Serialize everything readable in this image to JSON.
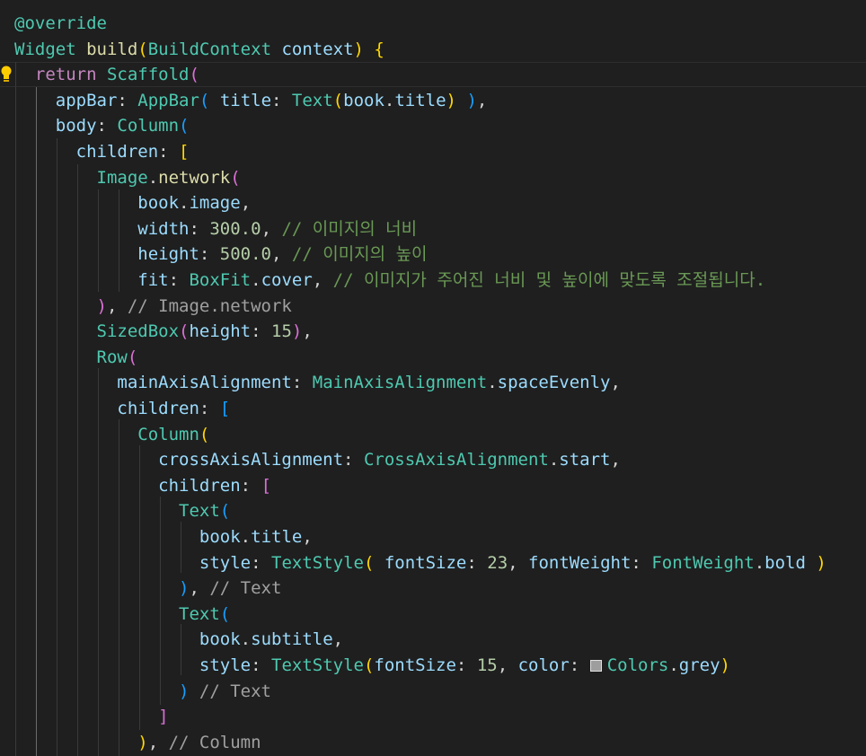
{
  "editor": {
    "theme": {
      "background": "#1f1f1f",
      "bracket_1": "#ffd700",
      "bracket_2": "#da70d6",
      "bracket_3": "#179fff"
    },
    "lightbulb_icon": "lightbulb-icon",
    "color_swatch": "#9e9e9e",
    "lines": [
      {
        "segs": [
          {
            "t": "@override",
            "c": "dec"
          }
        ]
      },
      {
        "segs": [
          {
            "t": "Widget ",
            "c": "ty"
          },
          {
            "t": "build",
            "c": "fn"
          },
          {
            "t": "(",
            "c": "b1"
          },
          {
            "t": "BuildContext ",
            "c": "ty"
          },
          {
            "t": "context",
            "c": "prop"
          },
          {
            "t": ") ",
            "c": "b1"
          },
          {
            "t": "{",
            "c": "b1"
          }
        ]
      },
      {
        "segs": [
          {
            "t": "  return ",
            "c": "kw"
          },
          {
            "t": "Scaffold",
            "c": "ty"
          },
          {
            "t": "(",
            "c": "b2"
          }
        ]
      },
      {
        "segs": [
          {
            "t": "    appBar",
            "c": "prop"
          },
          {
            "t": ": ",
            "c": "p"
          },
          {
            "t": "AppBar",
            "c": "ty"
          },
          {
            "t": "(",
            "c": "b3"
          },
          {
            "t": " title",
            "c": "prop"
          },
          {
            "t": ": ",
            "c": "p"
          },
          {
            "t": "Text",
            "c": "ty"
          },
          {
            "t": "(",
            "c": "b1"
          },
          {
            "t": "book",
            "c": "prop"
          },
          {
            "t": ".",
            "c": "p"
          },
          {
            "t": "title",
            "c": "prop"
          },
          {
            "t": ")",
            "c": "b1"
          },
          {
            "t": " ",
            "c": "p"
          },
          {
            "t": ")",
            "c": "b3"
          },
          {
            "t": ",",
            "c": "p"
          }
        ]
      },
      {
        "segs": [
          {
            "t": "    body",
            "c": "prop"
          },
          {
            "t": ": ",
            "c": "p"
          },
          {
            "t": "Column",
            "c": "ty"
          },
          {
            "t": "(",
            "c": "b3"
          }
        ]
      },
      {
        "segs": [
          {
            "t": "      children",
            "c": "prop"
          },
          {
            "t": ": ",
            "c": "p"
          },
          {
            "t": "[",
            "c": "b1"
          }
        ]
      },
      {
        "segs": [
          {
            "t": "        Image",
            "c": "ty"
          },
          {
            "t": ".",
            "c": "p"
          },
          {
            "t": "network",
            "c": "fn"
          },
          {
            "t": "(",
            "c": "b2"
          }
        ]
      },
      {
        "segs": [
          {
            "t": "            book",
            "c": "prop"
          },
          {
            "t": ".",
            "c": "p"
          },
          {
            "t": "image",
            "c": "prop"
          },
          {
            "t": ",",
            "c": "p"
          }
        ]
      },
      {
        "segs": [
          {
            "t": "            width",
            "c": "prop"
          },
          {
            "t": ": ",
            "c": "p"
          },
          {
            "t": "300.0",
            "c": "num"
          },
          {
            "t": ", ",
            "c": "p"
          },
          {
            "t": "// 이미지의 너비",
            "c": "cm"
          }
        ]
      },
      {
        "segs": [
          {
            "t": "            height",
            "c": "prop"
          },
          {
            "t": ": ",
            "c": "p"
          },
          {
            "t": "500.0",
            "c": "num"
          },
          {
            "t": ", ",
            "c": "p"
          },
          {
            "t": "// 이미지의 높이",
            "c": "cm"
          }
        ]
      },
      {
        "segs": [
          {
            "t": "            fit",
            "c": "prop"
          },
          {
            "t": ": ",
            "c": "p"
          },
          {
            "t": "BoxFit",
            "c": "ty"
          },
          {
            "t": ".",
            "c": "p"
          },
          {
            "t": "cover",
            "c": "prop"
          },
          {
            "t": ", ",
            "c": "p"
          },
          {
            "t": "// 이미지가 주어진 너비 및 높이에 맞도록 조절됩니다.",
            "c": "cm"
          }
        ]
      },
      {
        "segs": [
          {
            "t": "        )",
            "c": "b2"
          },
          {
            "t": ", ",
            "c": "p"
          },
          {
            "t": "// Image.network",
            "c": "gcm"
          }
        ]
      },
      {
        "segs": [
          {
            "t": "        SizedBox",
            "c": "ty"
          },
          {
            "t": "(",
            "c": "b2"
          },
          {
            "t": "height",
            "c": "prop"
          },
          {
            "t": ": ",
            "c": "p"
          },
          {
            "t": "15",
            "c": "num"
          },
          {
            "t": ")",
            "c": "b2"
          },
          {
            "t": ",",
            "c": "p"
          }
        ]
      },
      {
        "segs": [
          {
            "t": "        Row",
            "c": "ty"
          },
          {
            "t": "(",
            "c": "b2"
          }
        ]
      },
      {
        "segs": [
          {
            "t": "          mainAxisAlignment",
            "c": "prop"
          },
          {
            "t": ": ",
            "c": "p"
          },
          {
            "t": "MainAxisAlignment",
            "c": "ty"
          },
          {
            "t": ".",
            "c": "p"
          },
          {
            "t": "spaceEvenly",
            "c": "prop"
          },
          {
            "t": ",",
            "c": "p"
          }
        ]
      },
      {
        "segs": [
          {
            "t": "          children",
            "c": "prop"
          },
          {
            "t": ": ",
            "c": "p"
          },
          {
            "t": "[",
            "c": "b3"
          }
        ]
      },
      {
        "segs": [
          {
            "t": "            Column",
            "c": "ty"
          },
          {
            "t": "(",
            "c": "b1"
          }
        ]
      },
      {
        "segs": [
          {
            "t": "              crossAxisAlignment",
            "c": "prop"
          },
          {
            "t": ": ",
            "c": "p"
          },
          {
            "t": "CrossAxisAlignment",
            "c": "ty"
          },
          {
            "t": ".",
            "c": "p"
          },
          {
            "t": "start",
            "c": "prop"
          },
          {
            "t": ",",
            "c": "p"
          }
        ]
      },
      {
        "segs": [
          {
            "t": "              children",
            "c": "prop"
          },
          {
            "t": ": ",
            "c": "p"
          },
          {
            "t": "[",
            "c": "b2"
          }
        ]
      },
      {
        "segs": [
          {
            "t": "                Text",
            "c": "ty"
          },
          {
            "t": "(",
            "c": "b3"
          }
        ]
      },
      {
        "segs": [
          {
            "t": "                  book",
            "c": "prop"
          },
          {
            "t": ".",
            "c": "p"
          },
          {
            "t": "title",
            "c": "prop"
          },
          {
            "t": ",",
            "c": "p"
          }
        ]
      },
      {
        "segs": [
          {
            "t": "                  style",
            "c": "prop"
          },
          {
            "t": ": ",
            "c": "p"
          },
          {
            "t": "TextStyle",
            "c": "ty"
          },
          {
            "t": "(",
            "c": "b1"
          },
          {
            "t": " fontSize",
            "c": "prop"
          },
          {
            "t": ": ",
            "c": "p"
          },
          {
            "t": "23",
            "c": "num"
          },
          {
            "t": ", ",
            "c": "p"
          },
          {
            "t": "fontWeight",
            "c": "prop"
          },
          {
            "t": ": ",
            "c": "p"
          },
          {
            "t": "FontWeight",
            "c": "ty"
          },
          {
            "t": ".",
            "c": "p"
          },
          {
            "t": "bold",
            "c": "prop"
          },
          {
            "t": " ",
            "c": "p"
          },
          {
            "t": ")",
            "c": "b1"
          }
        ]
      },
      {
        "segs": [
          {
            "t": "                )",
            "c": "b3"
          },
          {
            "t": ", ",
            "c": "p"
          },
          {
            "t": "// Text",
            "c": "gcm"
          }
        ]
      },
      {
        "segs": [
          {
            "t": "                Text",
            "c": "ty"
          },
          {
            "t": "(",
            "c": "b3"
          }
        ]
      },
      {
        "segs": [
          {
            "t": "                  book",
            "c": "prop"
          },
          {
            "t": ".",
            "c": "p"
          },
          {
            "t": "subtitle",
            "c": "prop"
          },
          {
            "t": ",",
            "c": "p"
          }
        ]
      },
      {
        "segs": [
          {
            "t": "                  style",
            "c": "prop"
          },
          {
            "t": ": ",
            "c": "p"
          },
          {
            "t": "TextStyle",
            "c": "ty"
          },
          {
            "t": "(",
            "c": "b1"
          },
          {
            "t": "fontSize",
            "c": "prop"
          },
          {
            "t": ": ",
            "c": "p"
          },
          {
            "t": "15",
            "c": "num"
          },
          {
            "t": ", ",
            "c": "p"
          },
          {
            "t": "color",
            "c": "prop"
          },
          {
            "t": ": ",
            "c": "p"
          },
          {
            "t": "",
            "c": "swatch"
          },
          {
            "t": "Colors",
            "c": "ty"
          },
          {
            "t": ".",
            "c": "p"
          },
          {
            "t": "grey",
            "c": "prop"
          },
          {
            "t": ")",
            "c": "b1"
          }
        ]
      },
      {
        "segs": [
          {
            "t": "                ) ",
            "c": "b3"
          },
          {
            "t": "// Text",
            "c": "gcm"
          }
        ]
      },
      {
        "segs": [
          {
            "t": "              ]",
            "c": "b2"
          }
        ]
      },
      {
        "segs": [
          {
            "t": "            )",
            "c": "b1"
          },
          {
            "t": ", ",
            "c": "p"
          },
          {
            "t": "// Column",
            "c": "gcm"
          }
        ]
      }
    ]
  }
}
